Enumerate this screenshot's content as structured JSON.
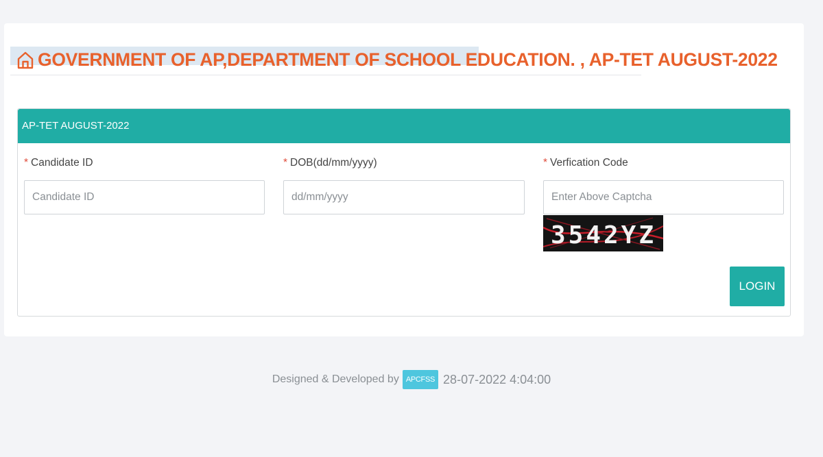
{
  "header": {
    "title": "GOVERNMENT OF AP,DEPARTMENT OF SCHOOL EDUCATION. , AP-TET AUGUST-2022",
    "icon": "home-icon",
    "color": "#e8612c"
  },
  "panel": {
    "title": "AP-TET AUGUST-2022",
    "accent_color": "#20ada5"
  },
  "form": {
    "candidate_id": {
      "required_mark": "*",
      "label": "Candidate ID",
      "placeholder": "Candidate ID",
      "value": ""
    },
    "dob": {
      "required_mark": "*",
      "label": "DOB(dd/mm/yyyy)",
      "placeholder": "dd/mm/yyyy",
      "value": ""
    },
    "verification": {
      "required_mark": "*",
      "label": "Verfication Code",
      "placeholder": "Enter Above Captcha",
      "value": ""
    },
    "captcha_text": "3542YZ",
    "login_label": "LOGIN"
  },
  "footer": {
    "designed_by": "Designed & Developed by",
    "brand": "APCFSS",
    "timestamp": "28-07-2022 4:04:00"
  }
}
